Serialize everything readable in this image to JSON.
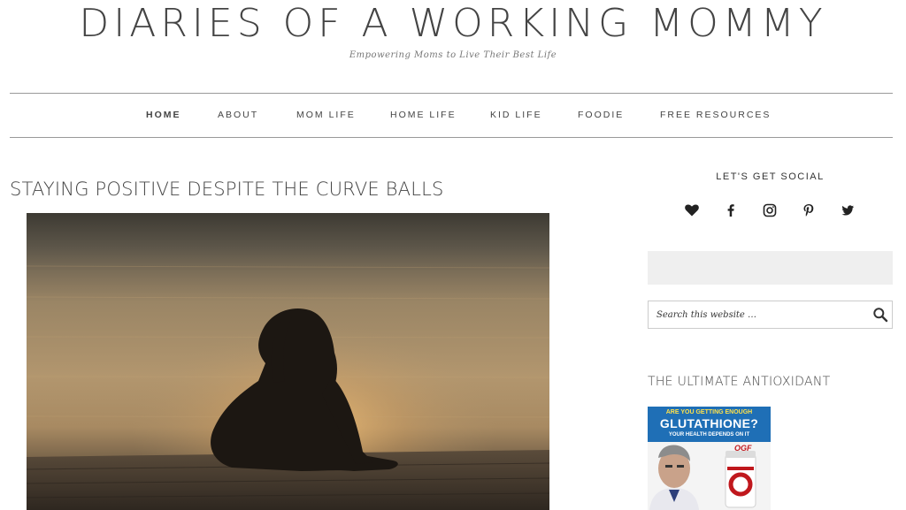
{
  "site": {
    "title": "DIARIES OF A WORKING MOMMY",
    "tagline": "Empowering Moms to Live Their Best Life"
  },
  "nav": {
    "items": [
      {
        "label": "HOME"
      },
      {
        "label": "ABOUT"
      },
      {
        "label": "MOM LIFE"
      },
      {
        "label": "HOME LIFE"
      },
      {
        "label": "KID LIFE"
      },
      {
        "label": "FOODIE"
      },
      {
        "label": "FREE RESOURCES"
      }
    ],
    "active": "HOME"
  },
  "post": {
    "title": "STAYING POSITIVE DESPITE THE CURVE BALLS"
  },
  "sidebar": {
    "social_heading": "LET'S GET SOCIAL",
    "social_icons": [
      "heart-icon",
      "facebook-icon",
      "instagram-icon",
      "pinterest-icon",
      "twitter-icon"
    ],
    "search": {
      "placeholder": "Search this website …"
    },
    "ad_heading": "THE ULTIMATE ANTIOXIDANT",
    "ad": {
      "line1": "ARE YOU GETTING ENOUGH",
      "line2": "GLUTATHIONE?",
      "line3": "YOUR HEALTH DEPENDS ON IT",
      "brand": "OGF"
    }
  },
  "colors": {
    "text": "#444444",
    "rule": "#999999",
    "ad_blue": "#1f6fb6",
    "ad_yellow": "#ffe14a",
    "ad_red": "#c0181d"
  }
}
